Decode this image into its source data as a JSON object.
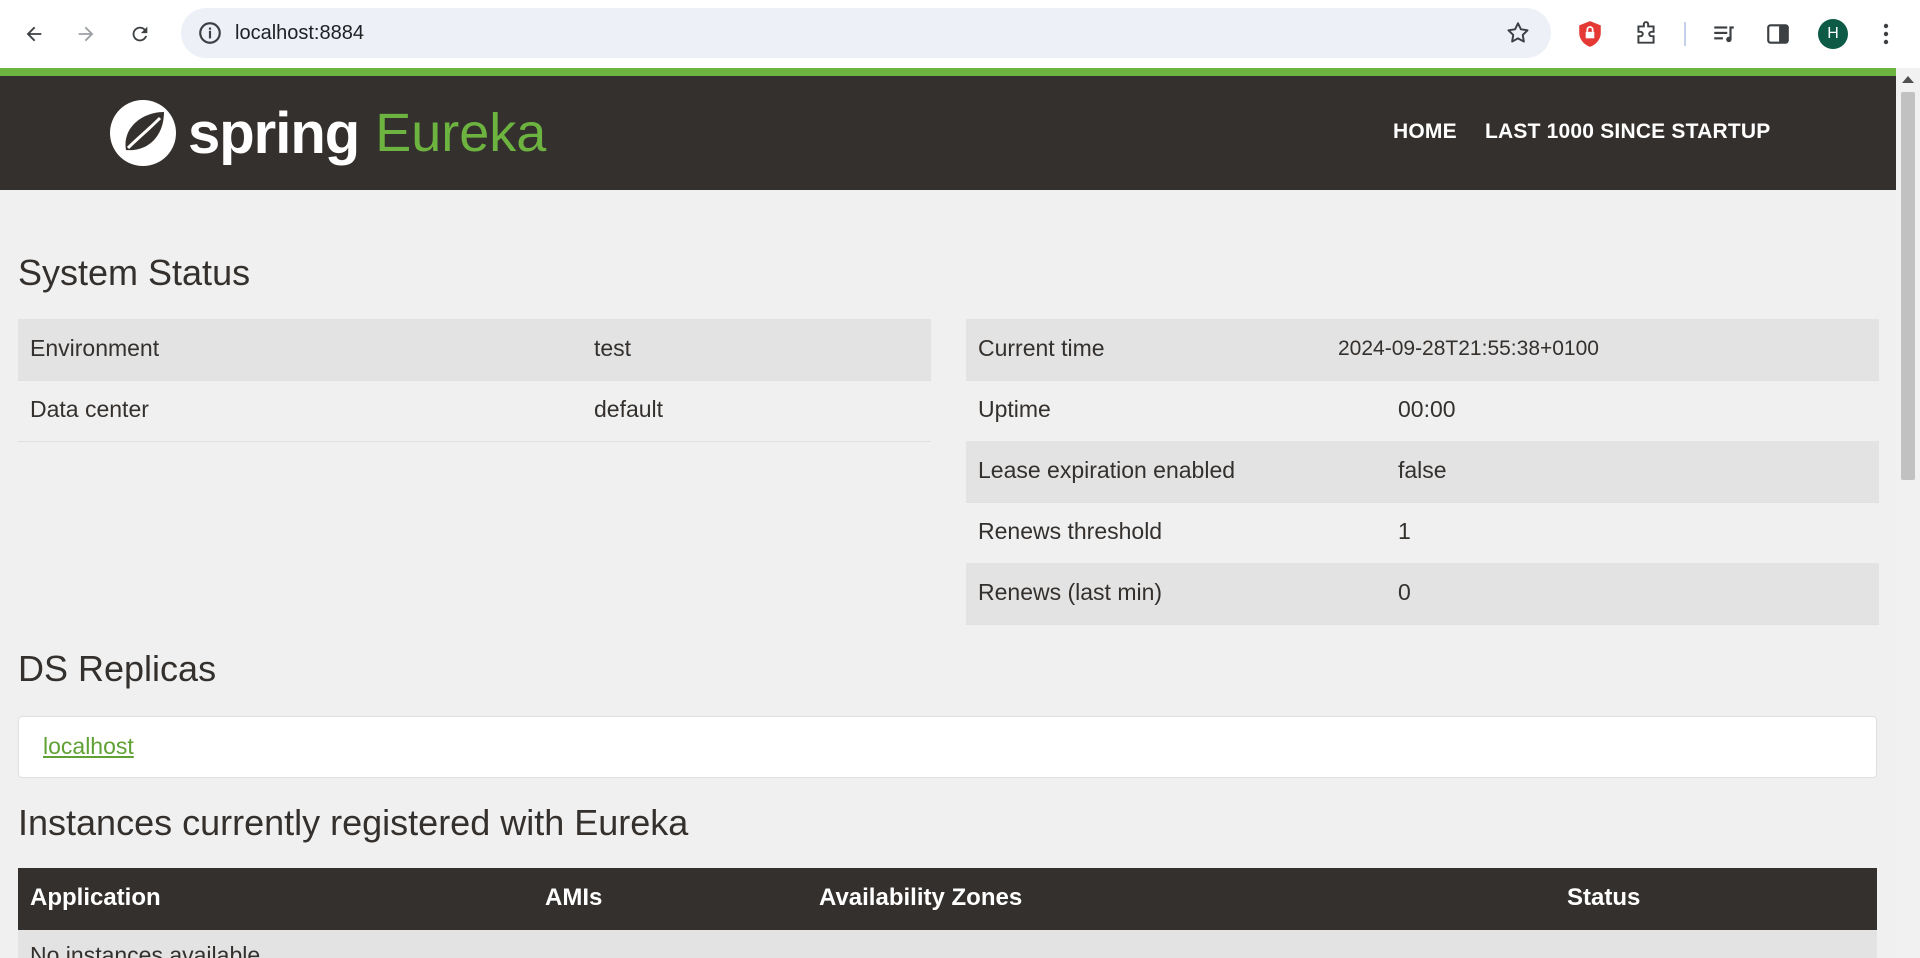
{
  "browser": {
    "url": "localhost:8884",
    "avatar_letter": "H"
  },
  "header": {
    "logo_word1": "spring",
    "logo_word2": "Eureka",
    "nav": [
      "HOME",
      "LAST 1000 SINCE STARTUP"
    ]
  },
  "system_status": {
    "title": "System Status",
    "left": [
      {
        "label": "Environment",
        "value": "test"
      },
      {
        "label": "Data center",
        "value": "default"
      }
    ],
    "right": [
      {
        "label": "Current time",
        "value": "2024-09-28T21:55:38+0100"
      },
      {
        "label": "Uptime",
        "value": "00:00"
      },
      {
        "label": "Lease expiration enabled",
        "value": "false"
      },
      {
        "label": "Renews threshold",
        "value": "1"
      },
      {
        "label": "Renews (last min)",
        "value": "0"
      }
    ]
  },
  "ds_replicas": {
    "title": "DS Replicas",
    "link": "localhost"
  },
  "instances": {
    "title": "Instances currently registered with Eureka",
    "columns": [
      "Application",
      "AMIs",
      "Availability Zones",
      "Status"
    ],
    "empty_text": "No instances available"
  },
  "colors": {
    "brand_green": "#6db33f",
    "header_bg": "#34302d"
  }
}
